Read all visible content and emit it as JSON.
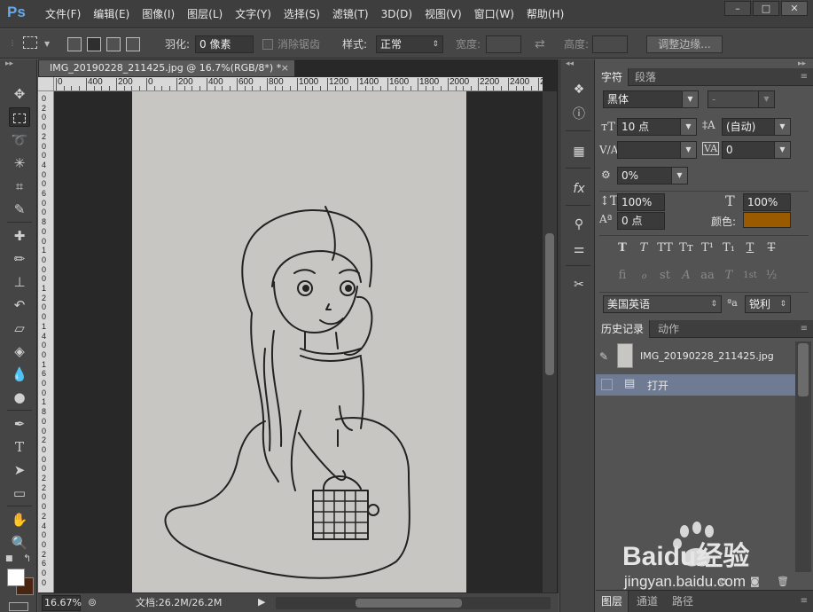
{
  "app": {
    "logo": "Ps"
  },
  "menu": [
    "文件(F)",
    "编辑(E)",
    "图像(I)",
    "图层(L)",
    "文字(Y)",
    "选择(S)",
    "滤镜(T)",
    "3D(D)",
    "视图(V)",
    "窗口(W)",
    "帮助(H)"
  ],
  "window_controls": {
    "minimize": "–",
    "maximize": "□",
    "close": "✕"
  },
  "options": {
    "feather_label": "羽化:",
    "feather_value": "0 像素",
    "antialias_label": "消除锯齿",
    "style_label": "样式:",
    "style_value": "正常",
    "width_label": "宽度:",
    "height_label": "高度:",
    "refine_edge_button": "调整边缘..."
  },
  "document": {
    "tab_title": "IMG_20190228_211425.jpg @ 16.7%(RGB/8*) *",
    "tab_close": "×",
    "ruler_top_labels": [
      "0",
      "400",
      "200",
      "0",
      "200",
      "400",
      "600",
      "800",
      "1000",
      "1200",
      "1400",
      "1600",
      "1800",
      "2000",
      "2200",
      "2400",
      "2600"
    ],
    "ruler_left_labels": [
      "0",
      "2",
      "0",
      "0",
      "2",
      "0",
      "0",
      "4",
      "0",
      "0",
      "6",
      "0",
      "0",
      "8",
      "0",
      "0",
      "1",
      "0",
      "0",
      "0",
      "1",
      "2",
      "0",
      "0",
      "1",
      "4",
      "0",
      "0",
      "1",
      "6",
      "0",
      "0",
      "1",
      "8",
      "0",
      "0",
      "2",
      "0",
      "0",
      "0",
      "2",
      "2",
      "0",
      "0",
      "2",
      "4",
      "0",
      "0",
      "2",
      "6",
      "0",
      "0"
    ],
    "zoom": "16.67%",
    "doc_size": "文档:26.2M/26.2M"
  },
  "character_panel": {
    "tabs": [
      "字符",
      "段落"
    ],
    "font_family": "黑体",
    "font_style": "-",
    "font_size": "10 点",
    "leading": "(自动)",
    "kerning": "",
    "tracking": "0",
    "scale_percent": "0%",
    "vertical_scale": "100%",
    "horizontal_scale": "100%",
    "baseline_shift": "0 点",
    "color_label": "颜色:",
    "color_value": "#9a5a00",
    "style_buttons": [
      "T",
      "T",
      "TT",
      "Tт",
      "T¹",
      "T₁",
      "T",
      "T"
    ],
    "opentype_buttons": [
      "fi",
      "ℴ",
      "st",
      "A",
      "aa",
      "T",
      "1st",
      "½"
    ],
    "language": "美国英语",
    "aa_icon": "ªa",
    "antialias": "锐利"
  },
  "history_panel": {
    "tabs": [
      "历史记录",
      "动作"
    ],
    "snapshot_name": "IMG_20190228_211425.jpg",
    "steps": [
      "打开"
    ]
  },
  "layers_panel": {
    "tabs": [
      "图层",
      "通道",
      "路径"
    ]
  },
  "watermark": "Baidu经验 jingyan.baidu.com"
}
